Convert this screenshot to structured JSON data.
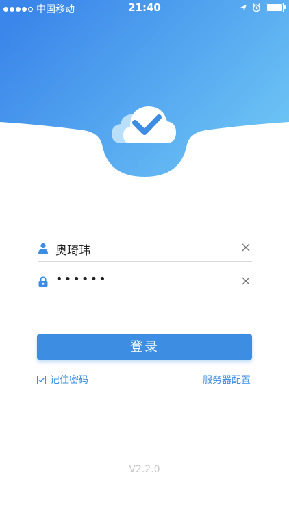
{
  "status_bar": {
    "carrier": "中国移动",
    "time": "21:40"
  },
  "login": {
    "username_value": "奥琦玮",
    "password_value": "••••••",
    "submit_label": "登录",
    "remember_label": "记住密码",
    "remember_checked": true,
    "server_config_label": "服务器配置"
  },
  "footer": {
    "version": "V2.2.0"
  },
  "colors": {
    "primary": "#3d8ee3",
    "header_gradient_start": "#3a86ea",
    "header_gradient_end": "#6ec6f5"
  },
  "icons": {
    "logo": "cloud-check-icon",
    "username": "user-icon",
    "password": "lock-icon",
    "clear": "close-icon",
    "remember": "checkbox-checked-icon"
  }
}
